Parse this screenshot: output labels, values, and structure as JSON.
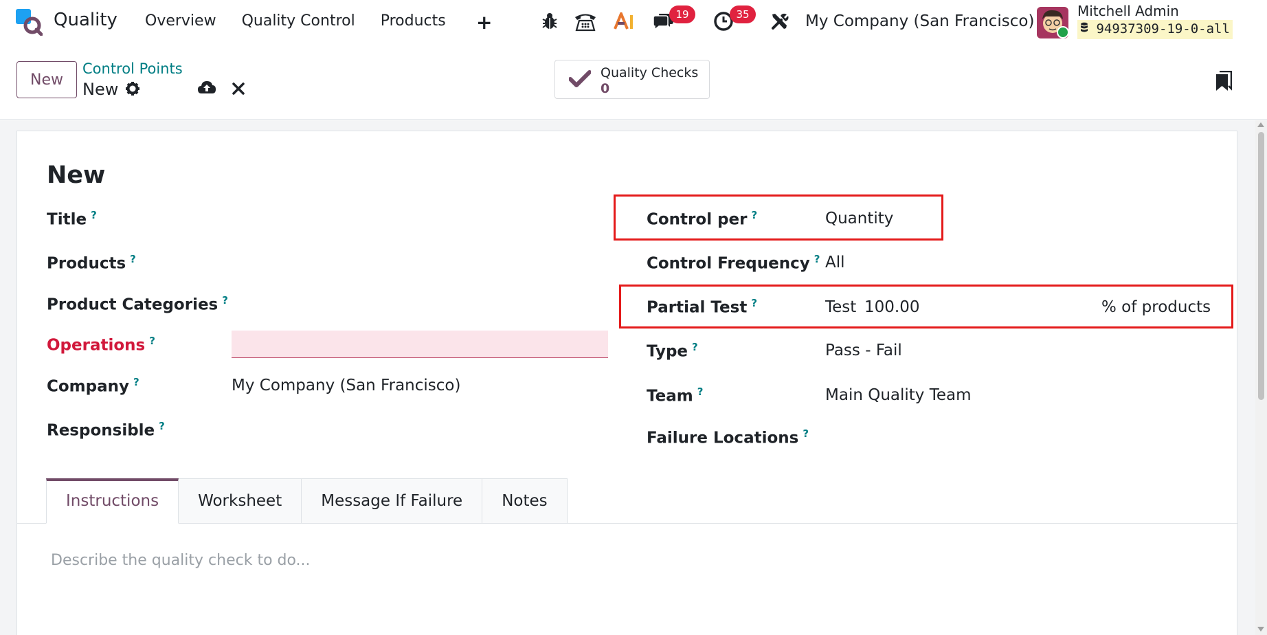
{
  "navbar": {
    "app_name": "Quality",
    "menu": [
      "Overview",
      "Quality Control",
      "Products"
    ],
    "plus": "+",
    "messages_badge": "19",
    "activities_badge": "35",
    "company": "My Company (San Francisco)",
    "user_name": "Mitchell Admin",
    "database": "94937309-19-0-all"
  },
  "control_panel": {
    "new_button": "New",
    "breadcrumb": "Control Points",
    "record_name": "New",
    "smart_button_label": "Quality Checks",
    "smart_button_value": "0"
  },
  "form": {
    "title": "New",
    "left_fields": {
      "title_label": "Title",
      "products_label": "Products",
      "categories_label": "Product Categories",
      "operations_label": "Operations",
      "company_label": "Company",
      "company_value": "My Company (San Francisco)",
      "responsible_label": "Responsible"
    },
    "right_fields": {
      "control_per_label": "Control per",
      "control_per_value": "Quantity",
      "frequency_label": "Control Frequency",
      "frequency_value": "All",
      "partial_label": "Partial Test",
      "partial_prefix": "Test",
      "partial_value": "100.00",
      "partial_suffix": "% of products",
      "type_label": "Type",
      "type_value": "Pass - Fail",
      "team_label": "Team",
      "team_value": "Main Quality Team",
      "failure_label": "Failure Locations"
    },
    "help_mark": "?",
    "tabs": [
      "Instructions",
      "Worksheet",
      "Message If Failure",
      "Notes"
    ],
    "instructions_placeholder": "Describe the quality check to do..."
  },
  "colors": {
    "brand": "#714b67",
    "link": "#017e84",
    "badge": "#e0223f",
    "highlight_box": "#e41a1a",
    "required": "#d1183b"
  },
  "icons": [
    "quality-logo-icon",
    "plus-icon",
    "bug-icon",
    "phone-icon",
    "ai-icon",
    "chat-icon",
    "clock-icon",
    "tools-icon",
    "gear-icon",
    "cloud-upload-icon",
    "close-icon",
    "check-icon",
    "bookmark-icon"
  ]
}
